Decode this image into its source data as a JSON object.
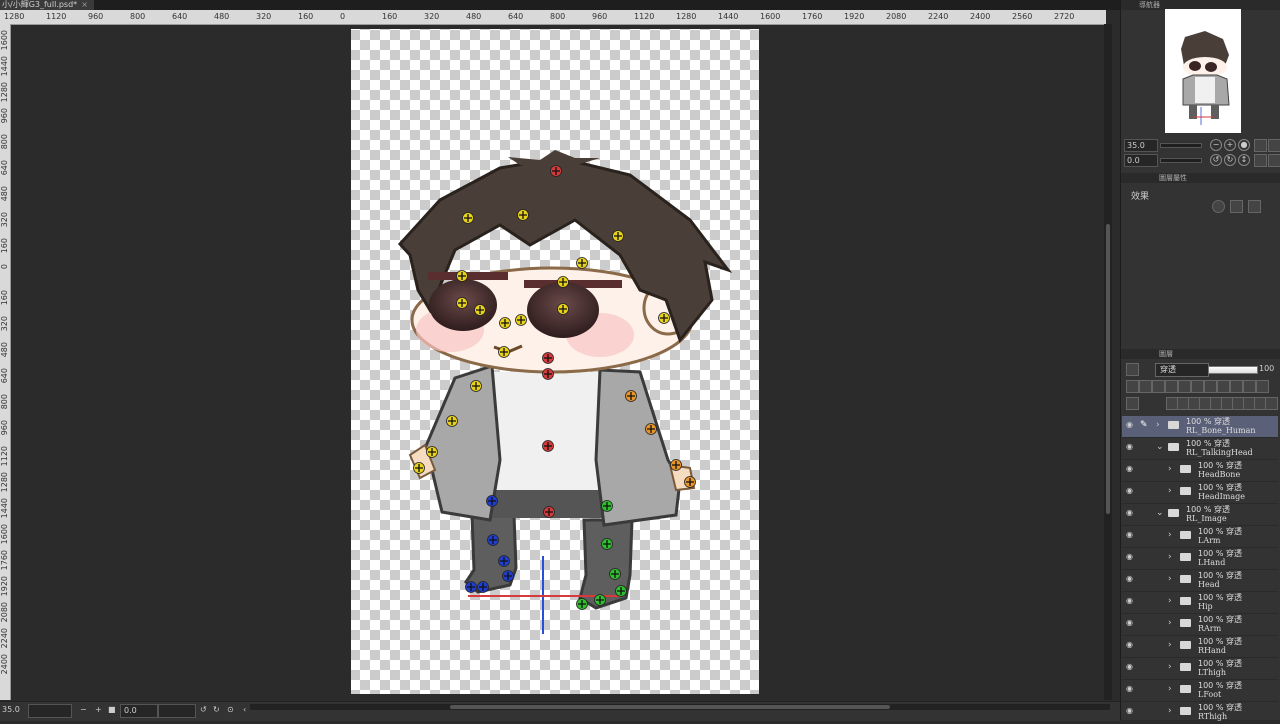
{
  "document": {
    "tab_title": "小/小輝G3_full.psd*",
    "close": "×"
  },
  "ruler": {
    "horizontal": [
      "1280",
      "1120",
      "960",
      "800",
      "640",
      "480",
      "320",
      "160",
      "0",
      "160",
      "320",
      "480",
      "640",
      "800",
      "960",
      "1120",
      "1280",
      "1440",
      "1600",
      "1760",
      "1920",
      "2080",
      "2240",
      "2400",
      "2560",
      "2720"
    ],
    "vertical": [
      "1600",
      "1440",
      "1280",
      "960",
      "800",
      "640",
      "480",
      "320",
      "160",
      "0",
      "160",
      "320",
      "480",
      "640",
      "800",
      "960",
      "1120",
      "1280",
      "1440",
      "1600",
      "1760",
      "1920",
      "2080",
      "2240",
      "2400"
    ]
  },
  "status": {
    "zoom": "35.0",
    "rotation": "0.0",
    "minus": "−",
    "plus": "+"
  },
  "navigator": {
    "panel_title": "導航器",
    "zoom": "35.0",
    "rotation": "0.0"
  },
  "layer_property": {
    "panel_title": "圖層屬性",
    "effect_label": "效果"
  },
  "layers_panel": {
    "panel_title": "圖層",
    "blend_mode": "穿透",
    "opacity": "100",
    "layers": [
      {
        "line1": "100 % 穿透",
        "line2": "RL_Bone_Human",
        "indent": 0,
        "expanded": false,
        "selected": true
      },
      {
        "line1": "100 % 穿透",
        "line2": "RL_TalkingHead",
        "indent": 0,
        "expanded": true,
        "selected": false
      },
      {
        "line1": "100 % 穿透",
        "line2": "HeadBone",
        "indent": 1,
        "expanded": false,
        "selected": false
      },
      {
        "line1": "100 % 穿透",
        "line2": "HeadImage",
        "indent": 1,
        "expanded": false,
        "selected": false
      },
      {
        "line1": "100 % 穿透",
        "line2": "RL_Image",
        "indent": 0,
        "expanded": true,
        "selected": false
      },
      {
        "line1": "100 % 穿透",
        "line2": "LArm",
        "indent": 1,
        "expanded": false,
        "selected": false
      },
      {
        "line1": "100 % 穿透",
        "line2": "LHand",
        "indent": 1,
        "expanded": false,
        "selected": false
      },
      {
        "line1": "100 % 穿透",
        "line2": "Head",
        "indent": 1,
        "expanded": false,
        "selected": false
      },
      {
        "line1": "100 % 穿透",
        "line2": "Hip",
        "indent": 1,
        "expanded": false,
        "selected": false
      },
      {
        "line1": "100 % 穿透",
        "line2": "RArm",
        "indent": 1,
        "expanded": false,
        "selected": false
      },
      {
        "line1": "100 % 穿透",
        "line2": "RHand",
        "indent": 1,
        "expanded": false,
        "selected": false
      },
      {
        "line1": "100 % 穿透",
        "line2": "LThigh",
        "indent": 1,
        "expanded": false,
        "selected": false
      },
      {
        "line1": "100 % 穿透",
        "line2": "LFoot",
        "indent": 1,
        "expanded": false,
        "selected": false
      },
      {
        "line1": "100 % 穿透",
        "line2": "RThigh",
        "indent": 1,
        "expanded": false,
        "selected": false
      }
    ]
  },
  "colors": {
    "head_bones": "#d63a3a",
    "right_arm_bones": "#e8d21c",
    "left_arm_bones": "#e8952a",
    "right_leg_bones": "#1f3ecf",
    "left_leg_bones": "#2fbf2f"
  }
}
